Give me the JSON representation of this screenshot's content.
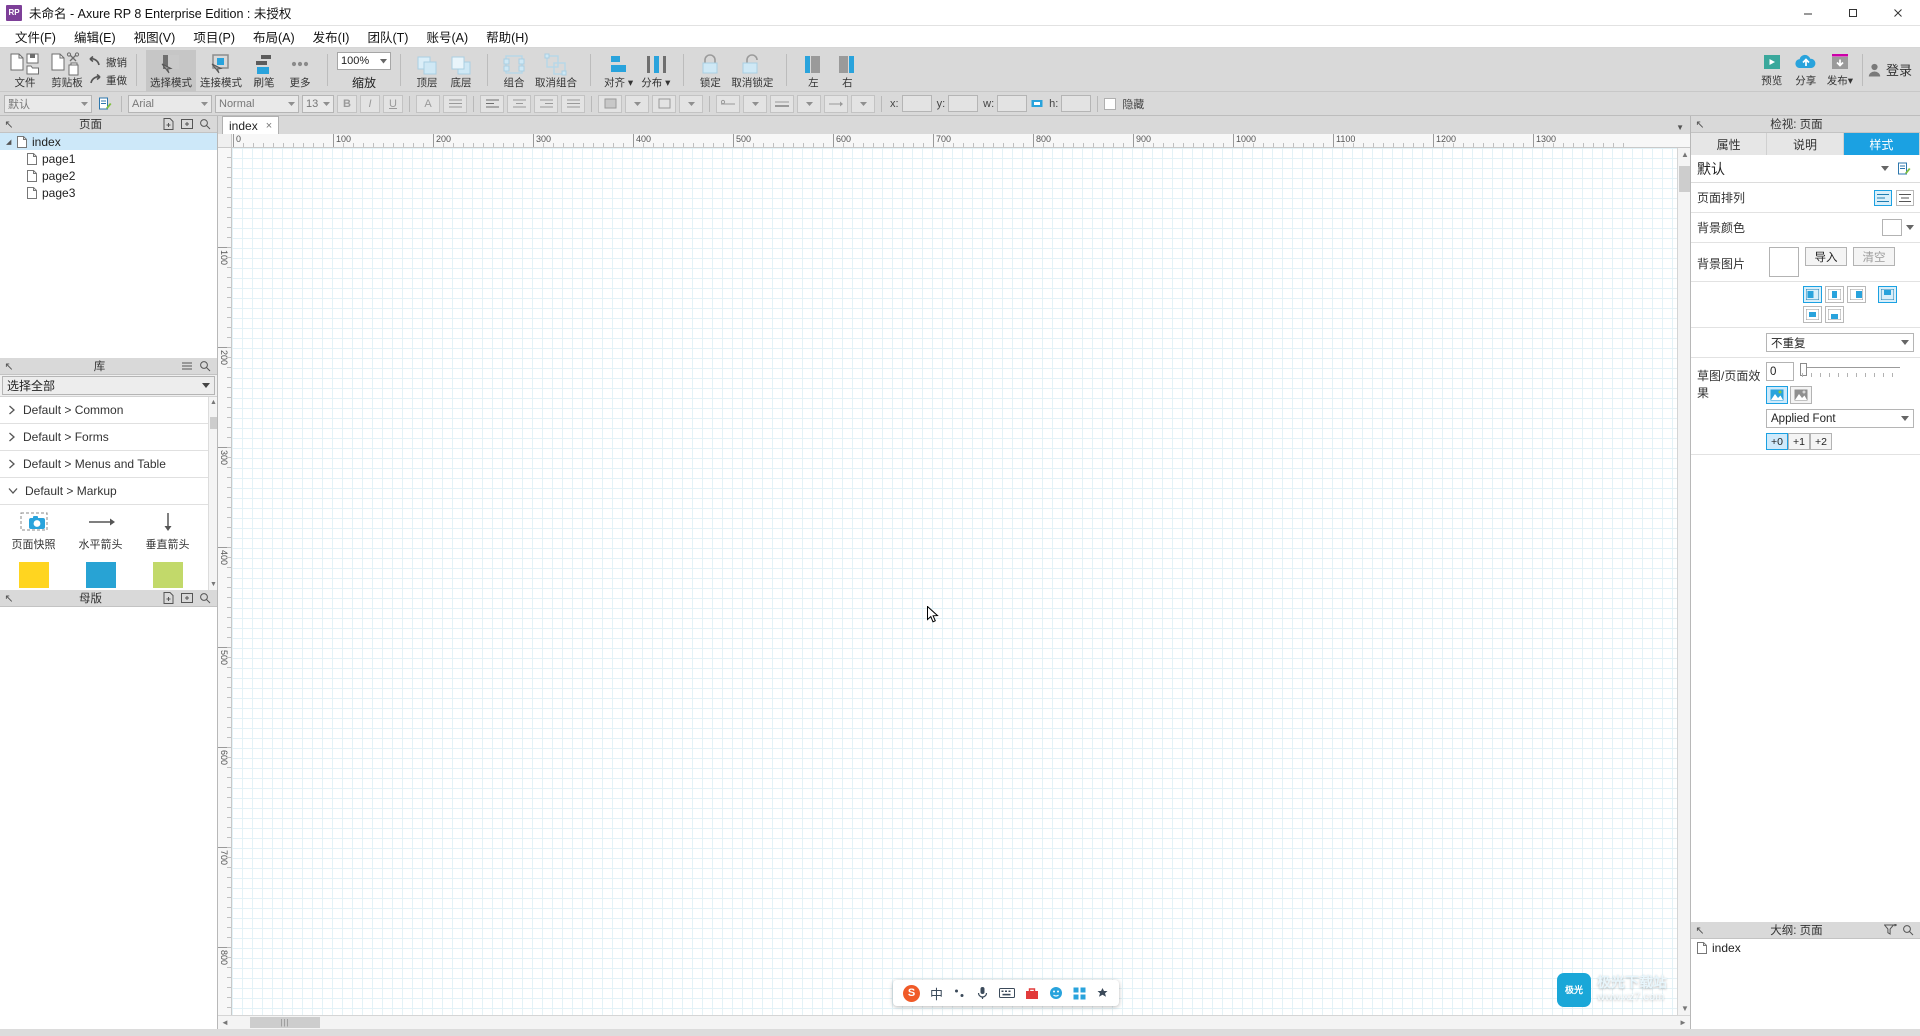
{
  "window": {
    "title": "未命名 - Axure RP 8 Enterprise Edition : 未授权",
    "logo": "RP",
    "minimize": "minimize-icon",
    "maximize": "maximize-icon",
    "close": "close-icon"
  },
  "menubar": {
    "items": [
      {
        "label": "文件(F)"
      },
      {
        "label": "编辑(E)"
      },
      {
        "label": "视图(V)"
      },
      {
        "label": "项目(P)"
      },
      {
        "label": "布局(A)"
      },
      {
        "label": "发布(I)"
      },
      {
        "label": "团队(T)"
      },
      {
        "label": "账号(A)"
      },
      {
        "label": "帮助(H)"
      }
    ]
  },
  "ribbon": {
    "file_label": "文件",
    "clipboard_label": "剪贴板",
    "undo_label": "撤销",
    "redo_label": "重做",
    "select_mode_label": "选择模式",
    "connect_mode_label": "连接模式",
    "format_painter_label": "刷笔",
    "more_label": "更多",
    "zoom_value": "100%",
    "zoom_label": "缩放",
    "bring_front_label": "顶层",
    "send_back_label": "底层",
    "group_label": "组合",
    "ungroup_label": "取消组合",
    "align_label": "对齐",
    "distribute_label": "分布",
    "lock_label": "锁定",
    "unlock_label": "取消锁定",
    "left_label": "左",
    "right_label": "右",
    "preview_label": "预览",
    "share_label": "分享",
    "publish_label": "发布",
    "login_label": "登录"
  },
  "formatbar": {
    "style_value": "默认",
    "font_value": "Arial",
    "weight_value": "Normal",
    "size_value": "13",
    "bold": "B",
    "italic": "I",
    "underline": "U",
    "font_color": "A",
    "x_label": "x:",
    "y_label": "y:",
    "w_label": "w:",
    "h_label": "h:",
    "x_value": "",
    "y_value": "",
    "w_value": "",
    "h_value": "",
    "hidden_label": "隐藏"
  },
  "pages_panel": {
    "title": "页面",
    "add_page_icon": "add-page-icon",
    "add_folder_icon": "add-folder-icon",
    "search_icon": "search-icon",
    "tree": [
      {
        "label": "index",
        "level": 0,
        "expanded": true,
        "selected": true
      },
      {
        "label": "page1",
        "level": 1,
        "expanded": false,
        "selected": false
      },
      {
        "label": "page2",
        "level": 1,
        "expanded": false,
        "selected": false
      },
      {
        "label": "page3",
        "level": 1,
        "expanded": false,
        "selected": false
      }
    ]
  },
  "library_panel": {
    "title": "库",
    "menu_icon": "hamburger-icon",
    "search_icon": "search-icon",
    "select_value": "选择全部",
    "categories": [
      {
        "label": "Default > Common",
        "expanded": false
      },
      {
        "label": "Default > Forms",
        "expanded": false
      },
      {
        "label": "Default > Menus and Table",
        "expanded": false
      },
      {
        "label": "Default > Markup",
        "expanded": true
      }
    ],
    "markup_items": [
      {
        "label": "页面快照",
        "icon": "snapshot-icon"
      },
      {
        "label": "水平箭头",
        "icon": "horizontal-arrow-icon"
      },
      {
        "label": "垂直箭头",
        "icon": "vertical-arrow-icon"
      }
    ],
    "swatches": [
      {
        "color": "#ffd520",
        "name": "yellow-sticky-note"
      },
      {
        "color": "#28a3d4",
        "name": "blue-sticky-note"
      },
      {
        "color": "#c2d96a",
        "name": "green-sticky-note"
      }
    ]
  },
  "masters_panel": {
    "title": "母版",
    "add_master_icon": "add-master-icon",
    "add_folder_icon": "add-folder-icon",
    "search_icon": "search-icon"
  },
  "canvas": {
    "tab_label": "index",
    "tab_close": "×",
    "h_ruler_ticks": [
      "0",
      "100",
      "200",
      "300",
      "400",
      "500",
      "600",
      "700",
      "800",
      "900",
      "1000",
      "1100",
      "1200",
      "1300"
    ],
    "v_ruler_ticks": [
      "100",
      "200",
      "300",
      "400",
      "500",
      "600",
      "700",
      "800"
    ],
    "scroll_grip": "|||"
  },
  "ime": {
    "logo": "S",
    "items": [
      "中",
      "✎",
      "🎤",
      "⌨",
      "Ｔ",
      "☺",
      "▦",
      "✿"
    ]
  },
  "watermark": {
    "badge": "极光",
    "title": "极光下载站",
    "sub": "www.xz7.com"
  },
  "inspector": {
    "title": "检视: 页面",
    "tabs": [
      {
        "label": "属性",
        "active": false
      },
      {
        "label": "说明",
        "active": false
      },
      {
        "label": "样式",
        "active": true
      }
    ],
    "style_name": "默认",
    "style_edit_icon": "edit-style-icon",
    "rows": {
      "page_align_label": "页面排列",
      "bg_color_label": "背景颜色",
      "bg_image_label": "背景图片",
      "import_label": "导入",
      "clear_label": "清空",
      "repeat_value": "不重复",
      "sketch_label": "草图/页面效果",
      "sketch_value": "0",
      "font_value": "Applied Font",
      "font_steps": [
        "+0",
        "+1",
        "+2"
      ]
    }
  },
  "outline_panel": {
    "title": "大纲: 页面",
    "filter_icon": "filter-icon",
    "search_icon": "search-icon",
    "items": [
      {
        "label": "index"
      }
    ]
  },
  "colors": {
    "accent": "#1ba1e2",
    "ribbon_bg": "#d9d9d9",
    "grid_line": "#c9e6ef",
    "selection": "#cde8f9"
  }
}
